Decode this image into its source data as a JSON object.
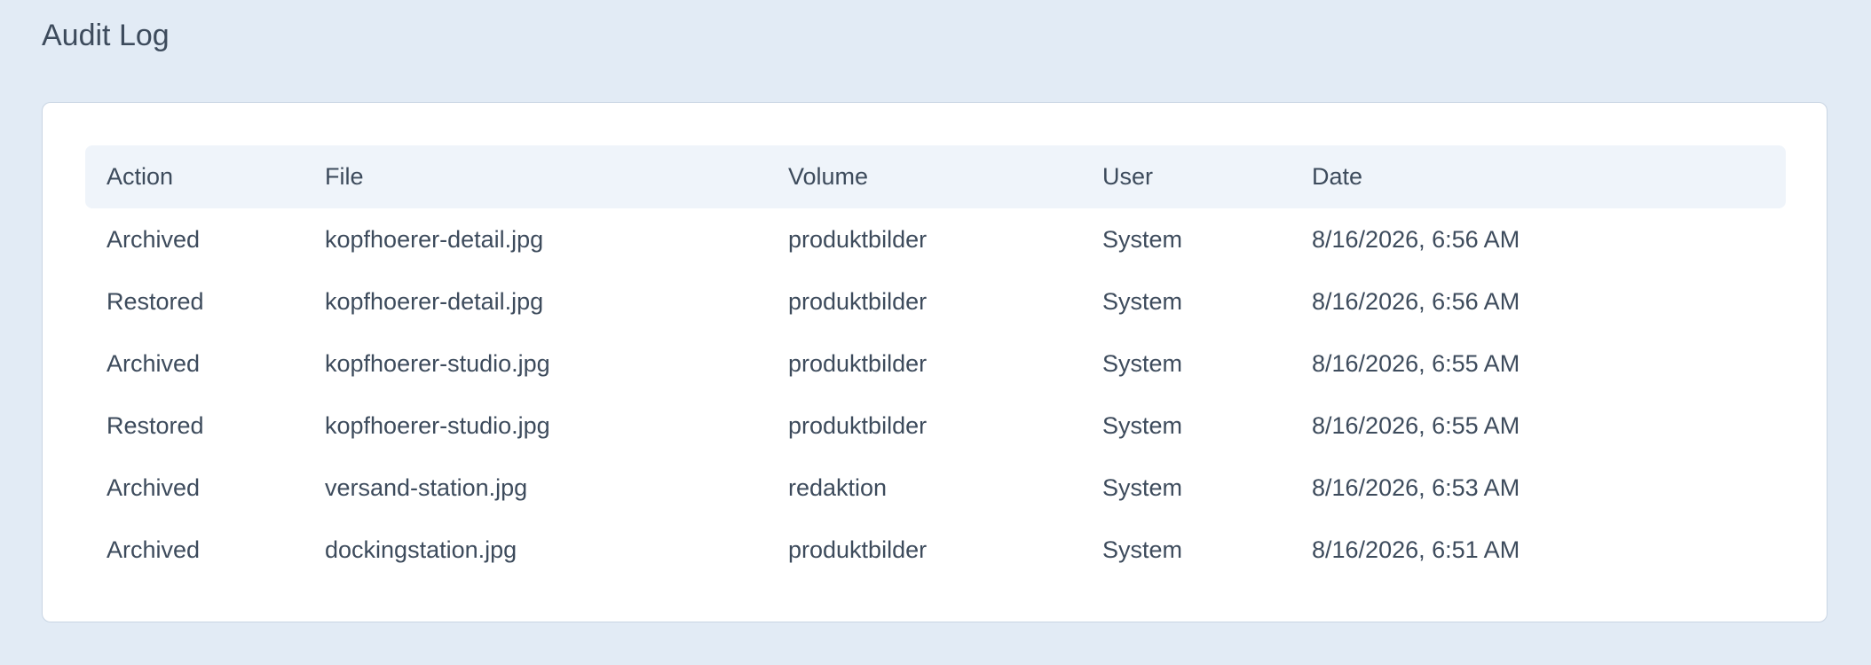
{
  "page": {
    "title": "Audit Log"
  },
  "table": {
    "columns": [
      "Action",
      "File",
      "Volume",
      "User",
      "Date"
    ],
    "rows": [
      {
        "action": "Archived",
        "file": "kopfhoerer-detail.jpg",
        "volume": "produktbilder",
        "user": "System",
        "date": "8/16/2026, 6:56 AM"
      },
      {
        "action": "Restored",
        "file": "kopfhoerer-detail.jpg",
        "volume": "produktbilder",
        "user": "System",
        "date": "8/16/2026, 6:56 AM"
      },
      {
        "action": "Archived",
        "file": "kopfhoerer-studio.jpg",
        "volume": "produktbilder",
        "user": "System",
        "date": "8/16/2026, 6:55 AM"
      },
      {
        "action": "Restored",
        "file": "kopfhoerer-studio.jpg",
        "volume": "produktbilder",
        "user": "System",
        "date": "8/16/2026, 6:55 AM"
      },
      {
        "action": "Archived",
        "file": "versand-station.jpg",
        "volume": "redaktion",
        "user": "System",
        "date": "8/16/2026, 6:53 AM"
      },
      {
        "action": "Archived",
        "file": "dockingstation.jpg",
        "volume": "produktbilder",
        "user": "System",
        "date": "8/16/2026, 6:51 AM"
      }
    ]
  },
  "colors": {
    "background": "#e2ebf5",
    "card": "#ffffff",
    "header_row": "#eff4fa",
    "text": "#3d4b5c"
  }
}
